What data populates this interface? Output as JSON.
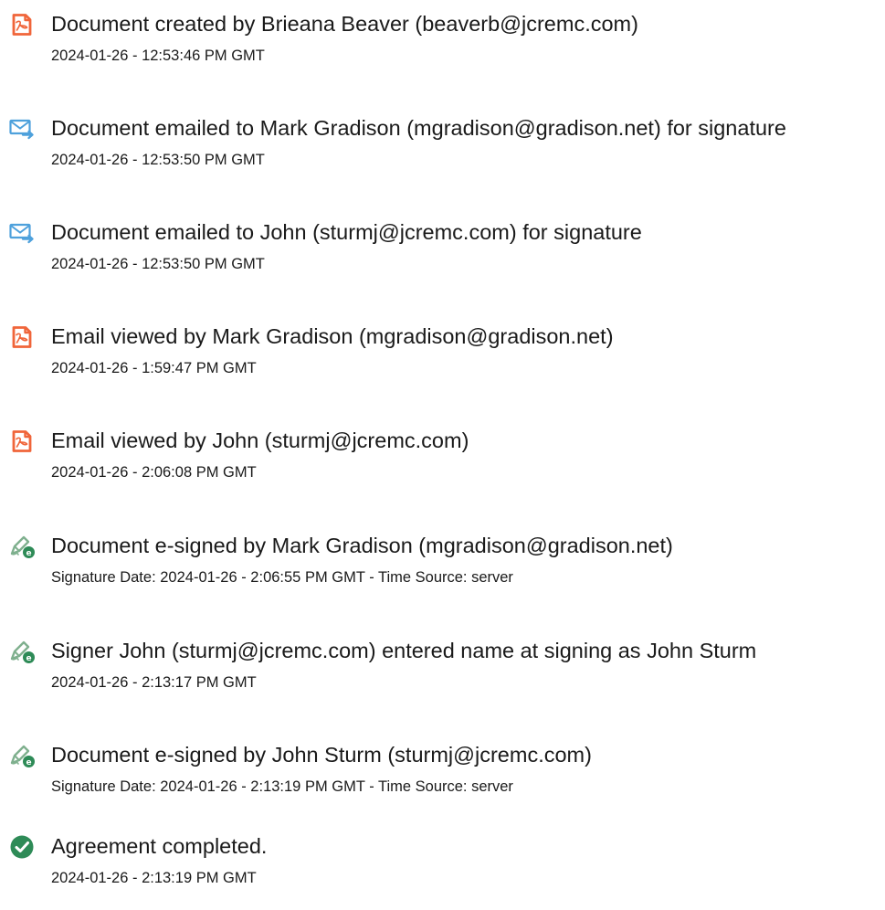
{
  "audit_events": [
    {
      "icon": "document-created-icon",
      "title": "Document created by Brieana Beaver (beaverb@jcremc.com)",
      "timestamp": "2024-01-26 - 12:53:46 PM GMT"
    },
    {
      "icon": "email-sent-icon",
      "title": "Document emailed to Mark Gradison (mgradison@gradison.net) for signature",
      "timestamp": "2024-01-26 - 12:53:50 PM GMT"
    },
    {
      "icon": "email-sent-icon",
      "title": "Document emailed to John (sturmj@jcremc.com) for signature",
      "timestamp": "2024-01-26 - 12:53:50 PM GMT"
    },
    {
      "icon": "email-viewed-icon",
      "title": "Email viewed by Mark Gradison (mgradison@gradison.net)",
      "timestamp": "2024-01-26 - 1:59:47 PM GMT"
    },
    {
      "icon": "email-viewed-icon",
      "title": "Email viewed by John (sturmj@jcremc.com)",
      "timestamp": "2024-01-26 - 2:06:08 PM GMT"
    },
    {
      "icon": "e-sign-icon",
      "title": "Document e-signed by Mark Gradison (mgradison@gradison.net)",
      "timestamp": "Signature Date: 2024-01-26 - 2:06:55 PM GMT - Time Source: server"
    },
    {
      "icon": "e-sign-icon",
      "title": "Signer John (sturmj@jcremc.com) entered name at signing as John Sturm",
      "timestamp": "2024-01-26 - 2:13:17 PM GMT"
    },
    {
      "icon": "e-sign-icon",
      "title": "Document e-signed by John Sturm (sturmj@jcremc.com)",
      "timestamp": "Signature Date: 2024-01-26 - 2:13:19 PM GMT - Time Source: server"
    },
    {
      "icon": "agreement-completed-icon",
      "title": "Agreement completed.",
      "timestamp": "2024-01-26 - 2:13:19 PM GMT"
    }
  ],
  "colors": {
    "document_icon": "#f0653a",
    "email_icon": "#4ea1dc",
    "sign_icon_stroke": "#7fb08e",
    "sign_icon_badge": "#2e8b57",
    "completed_icon": "#2e8b57"
  }
}
